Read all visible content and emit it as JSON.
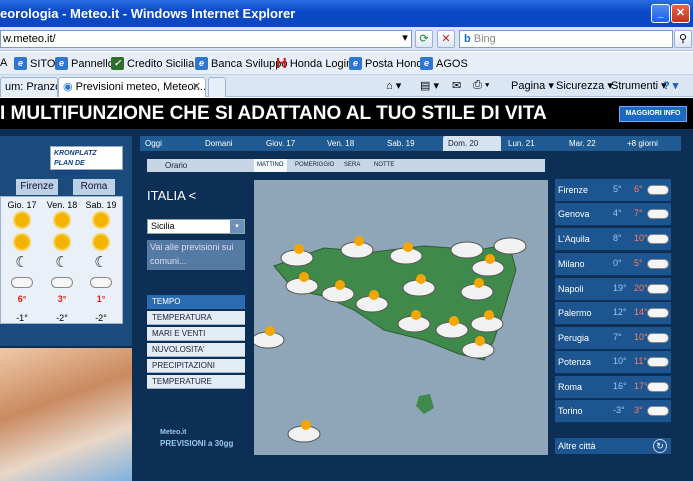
{
  "window": {
    "title": "eorologia - Meteo.it - Windows Internet Explorer"
  },
  "address": {
    "url": "w.meteo.it/",
    "search_placeholder": "Bing"
  },
  "favorites": [
    {
      "label": "A"
    },
    {
      "label": "SITO"
    },
    {
      "label": "Pannello"
    },
    {
      "label": "Credito Siciliano"
    },
    {
      "label": "Banca Sviluppo"
    },
    {
      "label": "Honda Login"
    },
    {
      "label": "Posta Honda"
    },
    {
      "label": "AGOS"
    }
  ],
  "tabs": [
    {
      "label": "um: Pranzo..."
    },
    {
      "label": "Previsioni meteo, Meteor..."
    }
  ],
  "commands": {
    "page": "Pagina",
    "security": "Sicurezza",
    "tools": "Strumenti"
  },
  "banner": {
    "text": "I MULTIFUNZIONE CHE SI ADATTANO AL TUO STILE DI VITA",
    "button": "MAGGIORI INFO"
  },
  "sponsor": {
    "line1": "KRONPLATZ",
    "line2": "PLAN DE CORONES"
  },
  "left_forecast": {
    "cities": [
      "Firenze",
      "Roma"
    ],
    "days": [
      "Gio. 17",
      "Ven. 18",
      "Sab. 19"
    ],
    "temps_max": [
      "6°",
      "3°",
      "1°"
    ],
    "temps_min": [
      "-1°",
      "-2°",
      "-2°"
    ]
  },
  "day_tabs": [
    "Oggi",
    "Domani",
    "Giov. 17",
    "Ven. 18",
    "Sab. 19",
    "Dom. 20",
    "Lun. 21",
    "Mar. 22",
    "+8 giorni"
  ],
  "sub_tabs": {
    "label": "Orario",
    "items": [
      "MATTINO",
      "POMERIGGIO",
      "SERA",
      "NOTTE"
    ]
  },
  "region": {
    "title": "ITALIA <",
    "select": "Sicilia",
    "goto": "Vai alle previsioni sui comuni..."
  },
  "menu": {
    "header": "TEMPO",
    "items": [
      "TEMPERATURA",
      "MARI E VENTI",
      "NUVOLOSITA'",
      "PRECIPITAZIONI",
      "TEMPERATURE"
    ]
  },
  "promo": {
    "brand": "Meteo.it",
    "text": "PREVISIONI a 30gg"
  },
  "city_list": [
    {
      "name": "Firenze",
      "min": "5°",
      "max": "6°"
    },
    {
      "name": "Genova",
      "min": "4°",
      "max": "7°"
    },
    {
      "name": "L'Aquila",
      "min": "8°",
      "max": "10°"
    },
    {
      "name": "Milano",
      "min": "0°",
      "max": "5°"
    },
    {
      "name": "Napoli",
      "min": "19°",
      "max": "20°"
    },
    {
      "name": "Palermo",
      "min": "12°",
      "max": "14°"
    },
    {
      "name": "Perugia",
      "min": "7°",
      "max": "10°"
    },
    {
      "name": "Potenza",
      "min": "10°",
      "max": "11°"
    },
    {
      "name": "Roma",
      "min": "16°",
      "max": "17°"
    },
    {
      "name": "Torino",
      "min": "-3°",
      "max": "3°"
    }
  ],
  "altre": {
    "label": "Altre città"
  }
}
